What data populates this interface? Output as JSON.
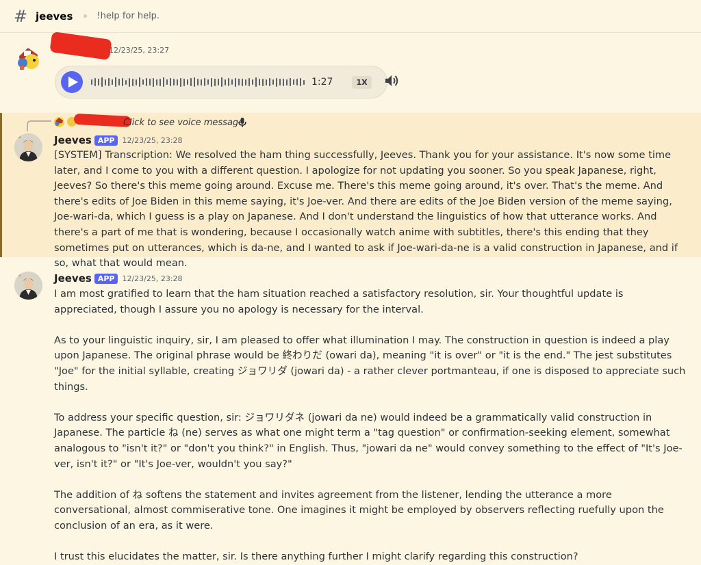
{
  "header": {
    "channel": "jeeves",
    "topic": "!help for help."
  },
  "user_message": {
    "timestamp": "12/23/25, 23:27",
    "voice": {
      "duration": "1:27",
      "speed": "1X"
    }
  },
  "reply_preview": {
    "text": "Click to see voice message"
  },
  "jeeves_msg1": {
    "author": "Jeeves",
    "tag": "APP",
    "timestamp": "12/23/25, 23:28",
    "text": "[SYSTEM] Transcription: We resolved the ham thing successfully, Jeeves. Thank you for your assistance. It's now some time later, and I come to you with a different question. I apologize for not updating you sooner. So you speak Japanese, right, Jeeves? So there's this meme going around. Excuse me. There's this meme going around, it's over. That's the meme. And there's edits of Joe Biden in this meme saying, it's Joe-ver. And there are edits of the Joe Biden version of the meme saying, Joe-wari-da, which I guess is a play on Japanese. And I don't understand the linguistics of how that utterance works. And there's a part of me that is wondering, because I occasionally watch anime with subtitles, there's this ending that they sometimes put on utterances, which is da-ne, and I wanted to ask if Joe-wari-da-ne is a valid construction in Japanese, and if so, what that would mean."
  },
  "jeeves_msg2": {
    "author": "Jeeves",
    "tag": "APP",
    "timestamp": "12/23/25, 23:28",
    "paragraphs": [
      "I am most gratified to learn that the ham situation reached a satisfactory resolution, sir. Your thoughtful update is appreciated, though I assure you no apology is necessary for the interval.",
      "As to your linguistic inquiry, sir, I am pleased to offer what illumination I may. The construction in question is indeed a play upon Japanese. The original phrase would be 終わりだ (owari da), meaning \"it is over\" or \"it is the end.\" The jest substitutes \"Joe\" for the initial syllable, creating ジョワリダ (jowari da) - a rather clever portmanteau, if one is disposed to appreciate such things.",
      "To address your specific question, sir: ジョワリダネ (jowari da ne) would indeed be a grammatically valid construction in Japanese. The particle ね (ne) serves as what one might term a \"tag question\" or confirmation-seeking element, somewhat analogous to \"isn't it?\" or \"don't you think?\" in English. Thus, \"jowari da ne\" would convey something to the effect of \"It's Joe-ver, isn't it?\" or \"It's Joe-ver, wouldn't you say?\"",
      "The addition of ね softens the statement and invites agreement from the listener, lending the utterance a more conversational, almost commiserative tone. One imagines it might be employed by observers reflecting ruefully upon the conclusion of an era, as it were.",
      "I trust this elucidates the matter, sir. Is there anything further I might clarify regarding this construction?"
    ]
  },
  "icons": {
    "channel": "hash-icon",
    "play": "play-icon",
    "volume": "speaker-icon",
    "mic": "microphone-icon"
  },
  "colors": {
    "accent": "#5865f2",
    "background": "#fdf6e3",
    "highlight": "#fbedcb",
    "redaction": "#ea2b1f"
  }
}
